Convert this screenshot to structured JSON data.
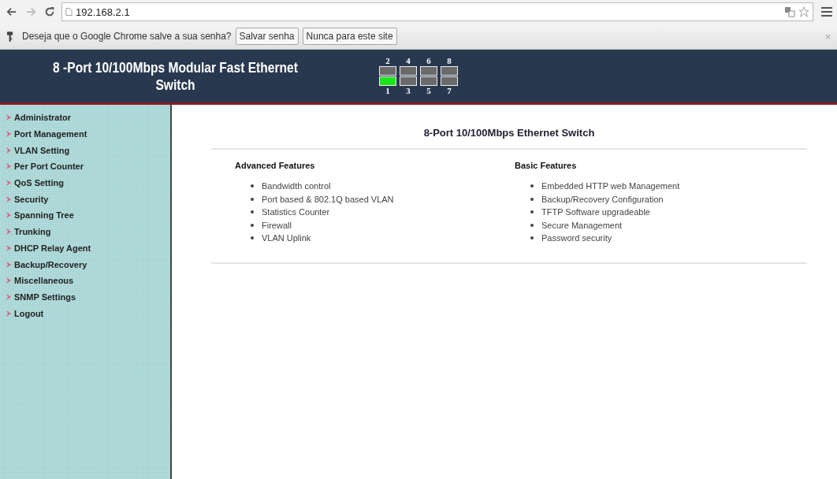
{
  "browser": {
    "url": "192.168.2.1"
  },
  "infobar": {
    "message": "Deseja que o Google Chrome salve a sua senha?",
    "buttons": [
      "Salvar senha",
      "Nunca para este site"
    ]
  },
  "header": {
    "title": "8 -Port 10/100Mbps Modular Fast Ethernet Switch",
    "ports_top": [
      {
        "label": "2",
        "link": false
      },
      {
        "label": "4",
        "link": false
      },
      {
        "label": "6",
        "link": false
      },
      {
        "label": "8",
        "link": false
      }
    ],
    "ports_bottom": [
      {
        "label": "1",
        "link": true
      },
      {
        "label": "3",
        "link": false
      },
      {
        "label": "5",
        "link": false
      },
      {
        "label": "7",
        "link": false
      }
    ]
  },
  "sidebar": {
    "items": [
      "Administrator",
      "Port Management",
      "VLAN Setting",
      "Per Port Counter",
      "QoS Setting",
      "Security",
      "Spanning Tree",
      "Trunking",
      "DHCP Relay Agent",
      "Backup/Recovery",
      "Miscellaneous",
      "SNMP Settings",
      "Logout"
    ]
  },
  "main": {
    "title": "8-Port 10/100Mbps Ethernet Switch",
    "sections": [
      {
        "heading": "Advanced Features",
        "items": [
          "Bandwidth control",
          "Port based & 802.1Q based VLAN",
          "Statistics Counter",
          "Firewall",
          "VLAN Uplink"
        ]
      },
      {
        "heading": "Basic Features",
        "items": [
          "Embedded HTTP web Management",
          "Backup/Recovery Configuration",
          "TFTP Software upgradeable",
          "Secure Management",
          "Password security"
        ]
      }
    ]
  }
}
